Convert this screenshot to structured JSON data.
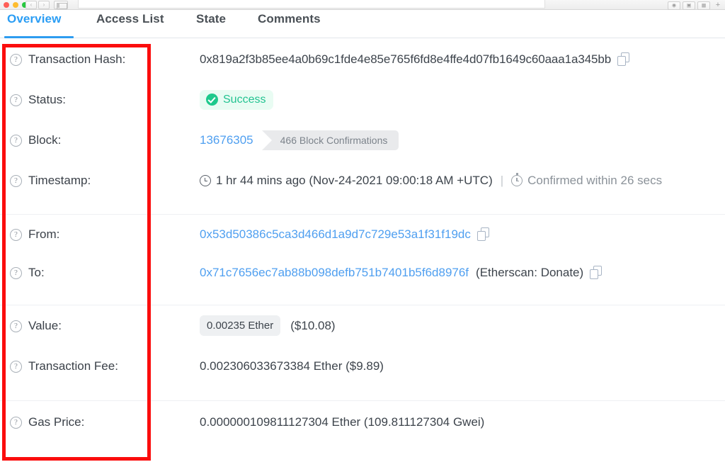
{
  "browser": {
    "traffic_lights": [
      "close",
      "minimize",
      "maximize"
    ],
    "back_label": "‹",
    "forward_label": "›",
    "sidebar_icon": "sidebar-icon",
    "share_icon": "share-icon",
    "save_icon": "save-icon",
    "tabs_icon": "tabs-icon",
    "new_tab_label": "+"
  },
  "tabs": [
    {
      "label": "Overview",
      "active": true
    },
    {
      "label": "Access List",
      "active": false
    },
    {
      "label": "State",
      "active": false
    },
    {
      "label": "Comments",
      "active": false
    }
  ],
  "overview": {
    "transaction_hash": {
      "label": "Transaction Hash:",
      "value": "0x819a2f3b85ee4a0b69c1fde4e85e765f6fd8e4ffe4d07fb1649c60aaa1a345bb",
      "copy_icon": "copy-icon"
    },
    "status": {
      "label": "Status:",
      "value": "Success",
      "icon": "check-circle-icon",
      "badge_bg": "#e9fcf3",
      "badge_fg": "#23c391"
    },
    "block": {
      "label": "Block:",
      "number": "13676305",
      "confirmations": "466 Block Confirmations"
    },
    "timestamp": {
      "label": "Timestamp:",
      "relative": "1 hr 44 mins ago (Nov-24-2021 09:00:18 AM +UTC)",
      "separator": "|",
      "confirmed_within": "Confirmed within 26 secs"
    },
    "from": {
      "label": "From:",
      "address": "0x53d50386c5ca3d466d1a9d7c729e53a1f31f19dc"
    },
    "to": {
      "label": "To:",
      "address": "0x71c7656ec7ab88b098defb751b7401b5f6d8976f",
      "tag": "(Etherscan: Donate)"
    },
    "value": {
      "label": "Value:",
      "ether": "0.00235 Ether",
      "fiat": "($10.08)"
    },
    "transaction_fee": {
      "label": "Transaction Fee:",
      "value": "0.002306033673384 Ether ($9.89)"
    },
    "gas_price": {
      "label": "Gas Price:",
      "value": "0.000000109811127304 Ether (109.811127304 Gwei)"
    }
  },
  "annotation": {
    "name": "red-highlight-box",
    "color": "#fb0d0d"
  }
}
